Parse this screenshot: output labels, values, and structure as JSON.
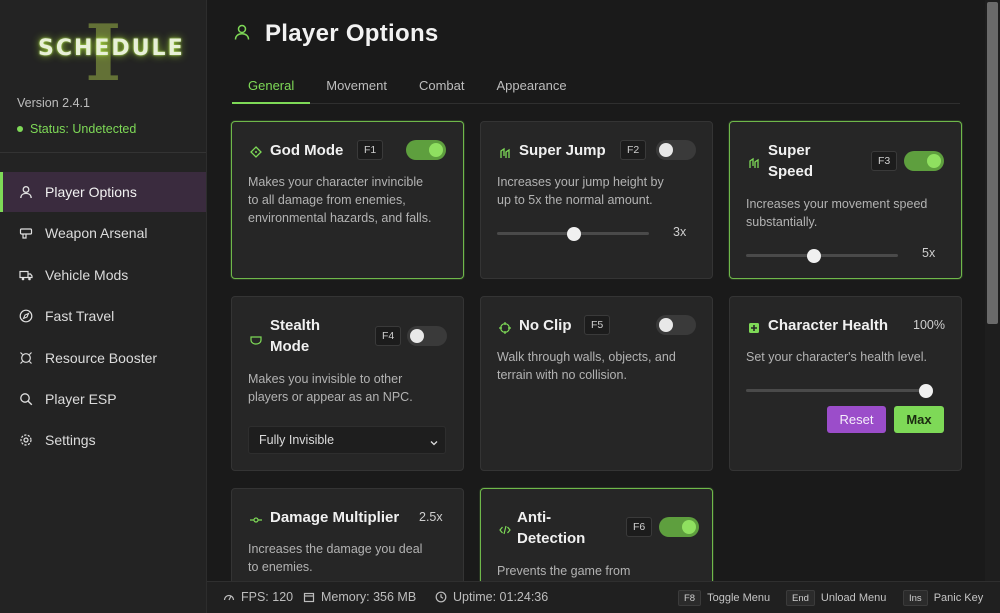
{
  "app": {
    "logo_text": "SCHEDULE",
    "logo_mark": "I",
    "version": "Version 2.4.1",
    "status": "Status: Undetected"
  },
  "sidebar": {
    "items": [
      {
        "label": "Player Options",
        "icon": "user-icon",
        "active": true
      },
      {
        "label": "Weapon Arsenal",
        "icon": "weapon-icon",
        "active": false
      },
      {
        "label": "Vehicle Mods",
        "icon": "truck-icon",
        "active": false
      },
      {
        "label": "Fast Travel",
        "icon": "compass-icon",
        "active": false
      },
      {
        "label": "Resource Booster",
        "icon": "booster-icon",
        "active": false
      },
      {
        "label": "Player ESP",
        "icon": "search-icon",
        "active": false
      },
      {
        "label": "Settings",
        "icon": "gear-icon",
        "active": false
      }
    ]
  },
  "header": {
    "title": "Player Options"
  },
  "tabs": [
    {
      "label": "General",
      "active": true
    },
    {
      "label": "Movement",
      "active": false
    },
    {
      "label": "Combat",
      "active": false
    },
    {
      "label": "Appearance",
      "active": false
    }
  ],
  "cards": {
    "god_mode": {
      "title": "God Mode",
      "key": "F1",
      "enabled": true,
      "desc": [
        "Makes your character invincible",
        "to all damage from enemies,",
        "environmental hazards, and falls."
      ]
    },
    "super_jump": {
      "title": "Super Jump",
      "key": "F2",
      "enabled": false,
      "desc": [
        "Increases your jump height by",
        "up to 5x the normal amount."
      ],
      "value_label": "3x",
      "value": 3,
      "max": 5
    },
    "super_speed": {
      "title_1": "Super",
      "title_2": "Speed",
      "key": "F3",
      "enabled": true,
      "desc": [
        "Increases your movement speed",
        "substantially."
      ],
      "value_label": "5x",
      "value": 5,
      "max": 5
    },
    "stealth": {
      "title_1": "Stealth",
      "title_2": "Mode",
      "key": "F4",
      "enabled": false,
      "desc": [
        "Makes you invisible to other",
        "players or appear as an NPC."
      ],
      "select_value": "Fully Invisible"
    },
    "no_clip": {
      "title": "No Clip",
      "key": "F5",
      "enabled": false,
      "desc": [
        "Walk through walls, objects, and",
        "terrain with no collision."
      ]
    },
    "health": {
      "title": "Character Health",
      "value_label": "100%",
      "value": 100,
      "desc": "Set your character's health level.",
      "reset_label": "Reset",
      "max_label": "Max"
    },
    "damage": {
      "title": "Damage Multiplier",
      "value_label": "2.5x",
      "desc": [
        "Increases the damage you deal",
        "to enemies."
      ]
    },
    "anti_detection": {
      "title_1": "Anti-",
      "title_2": "Detection",
      "key": "F6",
      "enabled": true,
      "desc": "Prevents the game from"
    }
  },
  "footer": {
    "fps": "FPS: 120",
    "memory": "Memory: 356 MB",
    "uptime": "Uptime: 01:24:36",
    "hints": [
      {
        "key": "F8",
        "label": "Toggle Menu"
      },
      {
        "key": "End",
        "label": "Unload Menu"
      },
      {
        "key": "Ins",
        "label": "Panic Key"
      }
    ]
  },
  "colors": {
    "accent": "#7ed957",
    "active_nav_bg": "#3a2b3e",
    "reset": "#9b4dca",
    "background": "#1a1a1a",
    "card": "#262626"
  }
}
